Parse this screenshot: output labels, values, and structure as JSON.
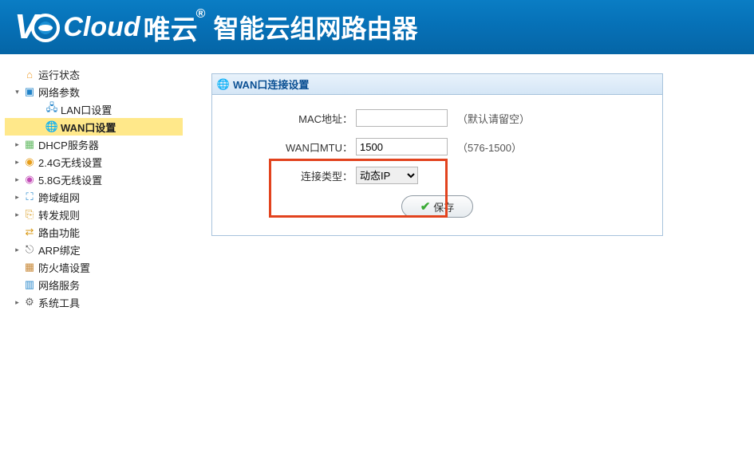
{
  "header": {
    "logo_text_prefix": "V",
    "logo_text_cloud": "Cloud",
    "logo_text_cn": "唯云",
    "logo_reg": "®",
    "tagline": "智能云组网路由器"
  },
  "sidebar": {
    "items": [
      {
        "name": "status",
        "label": "运行状态",
        "icon": "home",
        "toggle": "",
        "level": "root"
      },
      {
        "name": "netparam",
        "label": "网络参数",
        "icon": "net",
        "toggle": "▾",
        "level": "root",
        "expanded": true
      },
      {
        "name": "lan",
        "label": "LAN口设置",
        "icon": "lan",
        "toggle": "",
        "level": "child"
      },
      {
        "name": "wan",
        "label": "WAN口设置",
        "icon": "wan",
        "toggle": "",
        "level": "child",
        "selected": true
      },
      {
        "name": "dhcp",
        "label": "DHCP服务器",
        "icon": "dhcp",
        "toggle": "▸",
        "level": "root"
      },
      {
        "name": "wifi24",
        "label": "2.4G无线设置",
        "icon": "wifi1",
        "toggle": "▸",
        "level": "root"
      },
      {
        "name": "wifi58",
        "label": "5.8G无线设置",
        "icon": "wifi2",
        "toggle": "▸",
        "level": "root"
      },
      {
        "name": "crossnet",
        "label": "跨域组网",
        "icon": "cross",
        "toggle": "▸",
        "level": "root"
      },
      {
        "name": "forward",
        "label": "转发规则",
        "icon": "fwd",
        "toggle": "▸",
        "level": "root"
      },
      {
        "name": "routing",
        "label": "路由功能",
        "icon": "route",
        "toggle": "",
        "level": "root"
      },
      {
        "name": "arp",
        "label": "ARP绑定",
        "icon": "arp",
        "toggle": "▸",
        "level": "root"
      },
      {
        "name": "firewall",
        "label": "防火墙设置",
        "icon": "fw",
        "toggle": "",
        "level": "root"
      },
      {
        "name": "netsvc",
        "label": "网络服务",
        "icon": "svc",
        "toggle": "",
        "level": "root"
      },
      {
        "name": "systool",
        "label": "系统工具",
        "icon": "sys",
        "toggle": "▸",
        "level": "root"
      }
    ]
  },
  "panel": {
    "title": "WAN口连接设置",
    "mac_label": "MAC地址：",
    "mac_value": "",
    "mac_hint": "（默认请留空）",
    "mtu_label": "WAN口MTU：",
    "mtu_value": "1500",
    "mtu_hint": "（576-1500）",
    "conn_label": "连接类型：",
    "conn_value": "动态IP",
    "save_label": "保存"
  },
  "icons": {
    "home": "⌂",
    "net": "▣",
    "lan": "🖧",
    "wan": "🌐",
    "dhcp": "▦",
    "wifi1": "◉",
    "wifi2": "◉",
    "cross": "⛶",
    "fwd": "⎘",
    "route": "⇄",
    "arp": "⎋",
    "fw": "▦",
    "svc": "▥",
    "sys": "⚙"
  }
}
